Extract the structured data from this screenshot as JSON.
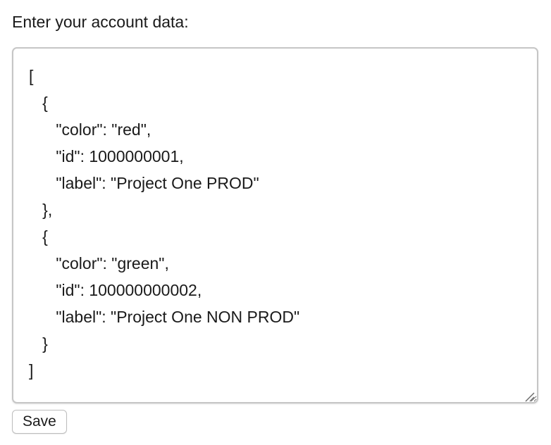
{
  "form": {
    "label": "Enter your account data:",
    "textarea_value": "[\n   {\n      \"color\": \"red\",\n      \"id\": 1000000001,\n      \"label\": \"Project One PROD\"\n   },\n   {\n      \"color\": \"green\",\n      \"id\": 100000000002,\n      \"label\": \"Project One NON PROD\"\n   }\n]",
    "save_label": "Save"
  },
  "icons": {
    "resize_grip": "resize-grip-icon"
  },
  "colors": {
    "text": "#1a1a1a",
    "border": "#c6c6c6",
    "background": "#ffffff"
  }
}
